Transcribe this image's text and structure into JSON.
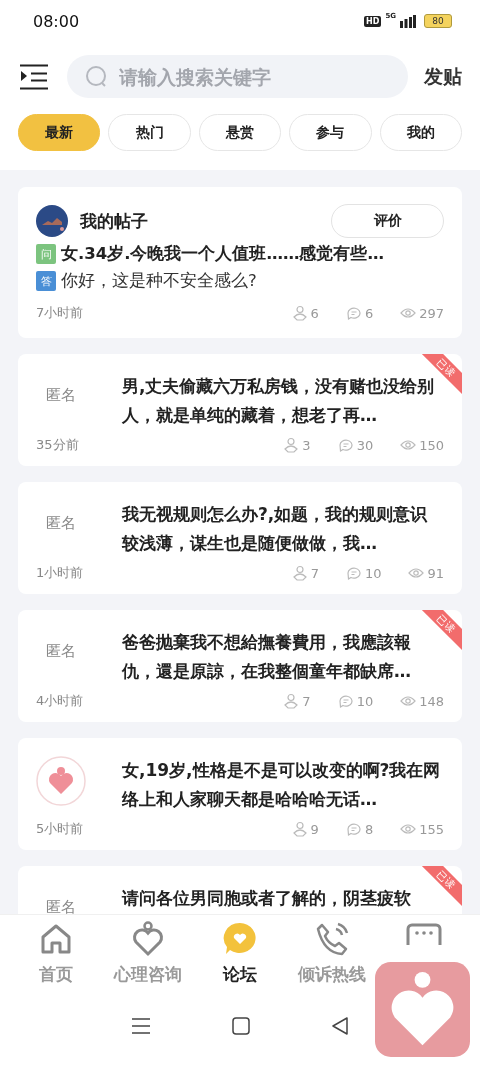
{
  "status_bar": {
    "time": "08:00",
    "hd": "HD",
    "network": "5G",
    "battery": "80"
  },
  "header": {
    "search": {
      "placeholder": "请输入搜索关键字"
    },
    "post_button": "发贴"
  },
  "tabs": [
    {
      "label": "最新",
      "selected": true
    },
    {
      "label": "热门",
      "selected": false
    },
    {
      "label": "悬赏",
      "selected": false
    },
    {
      "label": "参与",
      "selected": false
    },
    {
      "label": "我的",
      "selected": false
    }
  ],
  "my_post": {
    "title": "我的帖子",
    "button": "评价",
    "question_tag": "问",
    "question": "女.34岁.今晚我一个人值班……感觉有些…",
    "answer_tag": "答",
    "answer": "你好，这是种不安全感么?",
    "time": "7小时前",
    "likes": "6",
    "comments": "6",
    "views": "297"
  },
  "posts": [
    {
      "author": "匿名",
      "kind": "anonymous",
      "read": true,
      "read_label": "已读",
      "title": "男,丈夫偷藏六万私房钱，没有赌也没给别人，就是单纯的藏着，想老了再…",
      "time": "35分前",
      "likes": "3",
      "comments": "30",
      "views": "150"
    },
    {
      "author": "匿名",
      "kind": "anonymous",
      "read": false,
      "title": "我无视规则怎么办?,如题，我的规则意识较浅薄，谋生也是随便做做，我…",
      "time": "1小时前",
      "likes": "7",
      "comments": "10",
      "views": "91"
    },
    {
      "author": "匿名",
      "kind": "anonymous",
      "read": true,
      "read_label": "已读",
      "title": "爸爸抛棄我不想給撫養費用，我應該報仇，還是原諒，在我整個童年都缺席…",
      "time": "4小时前",
      "likes": "7",
      "comments": "10",
      "views": "148"
    },
    {
      "kind": "avatar",
      "read": false,
      "title": "女,19岁,性格是不是可以改变的啊?我在网络上和人家聊天都是哈哈哈无话…",
      "time": "5小时前",
      "likes": "9",
      "comments": "8",
      "views": "155"
    },
    {
      "author": "匿名",
      "kind": "anonymous",
      "read": true,
      "read_label": "已读",
      "title": "请问各位男同胞或者了解的，阴茎疲软"
    }
  ],
  "bottom_nav": [
    {
      "label": "首页",
      "selected": false
    },
    {
      "label": "心理咨询",
      "selected": false
    },
    {
      "label": "论坛",
      "selected": true
    },
    {
      "label": "倾诉热线",
      "selected": false
    },
    {
      "selected": false
    }
  ]
}
